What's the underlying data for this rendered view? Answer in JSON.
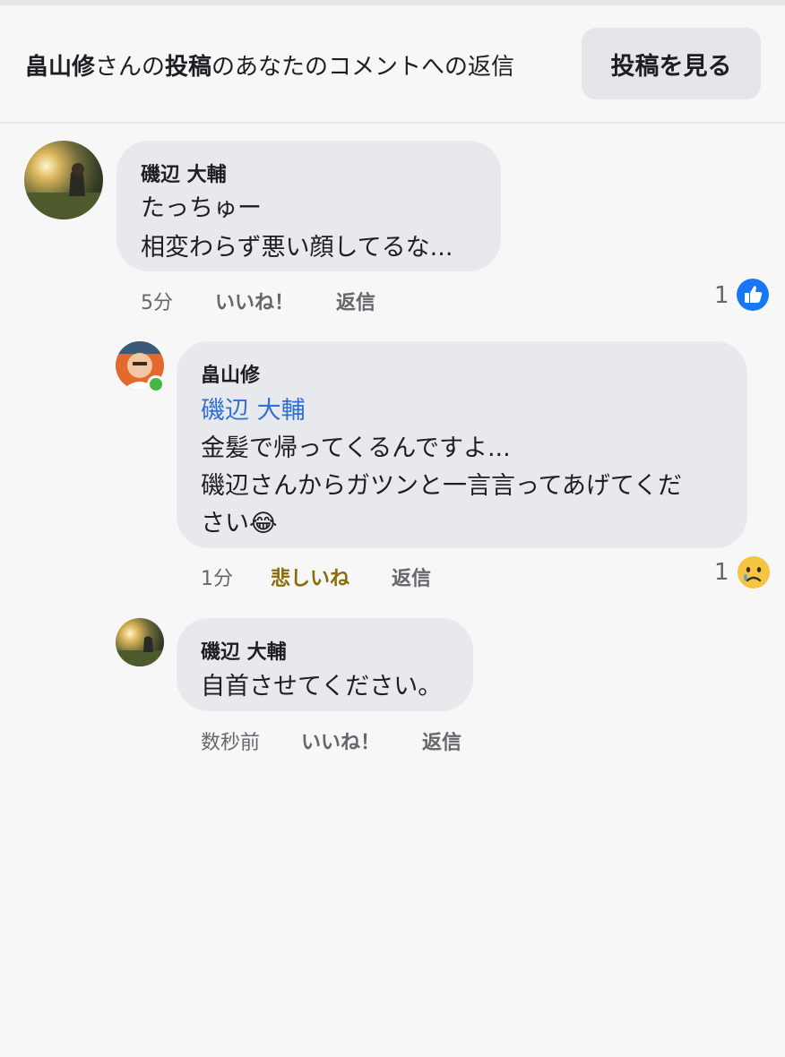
{
  "header": {
    "owner_name": "畠山修",
    "text_middle": "さんの",
    "post_word": "投稿",
    "text_end": "のあなたのコメントへの返信",
    "view_button": "投稿を見る"
  },
  "comments": [
    {
      "author": "磯辺 大輔",
      "lines": [
        "たっちゅー",
        "相変わらず悪い顔してるな..."
      ],
      "time": "5分",
      "like_label": "いいね！",
      "reply_label": "返信",
      "reaction_count": "1",
      "reaction_icon": "like-icon"
    },
    {
      "author": "畠山修",
      "mention": "磯辺 大輔",
      "lines": [
        "金髪で帰ってくるんですよ...",
        "磯辺さんからガツンと一言言ってあげてくだ",
        "さい😂"
      ],
      "time": "1分",
      "like_label": "悲しいね",
      "reply_label": "返信",
      "reaction_count": "1",
      "reaction_icon": "sad-icon"
    },
    {
      "author": "磯辺 大輔",
      "lines": [
        "自首させてください。"
      ],
      "time": "数秒前",
      "like_label": "いいね！",
      "reply_label": "返信"
    }
  ],
  "colors": {
    "like_blue": "#1877f2",
    "sad_text": "#8a6d0a",
    "mention_blue": "#2f6fd6",
    "online_green": "#43b842"
  }
}
